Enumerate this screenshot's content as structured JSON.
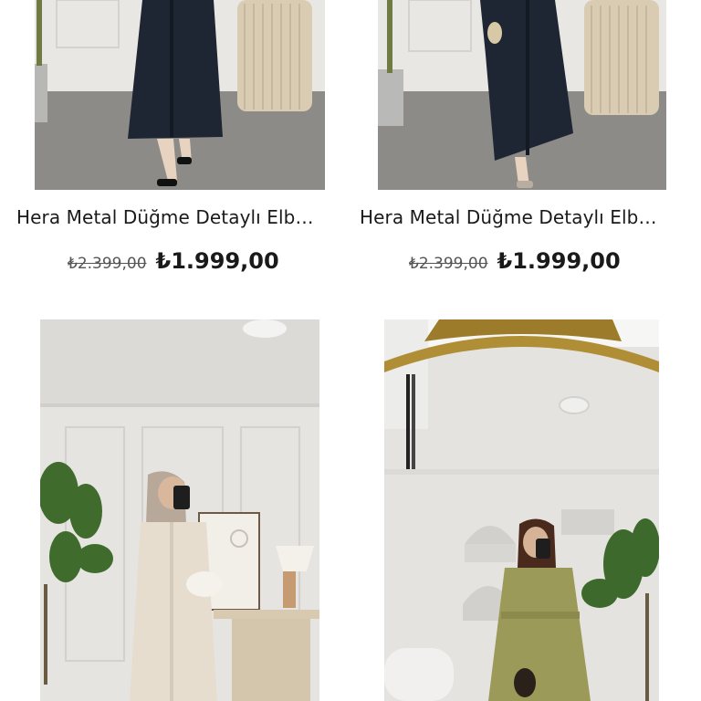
{
  "products": [
    {
      "name": "Hera Metal Düğme Detaylı Elb…",
      "old_price": "₺2.399,00",
      "price": "₺1.999,00",
      "image": "navy-shirt-dress-photo"
    },
    {
      "name": "Hera Metal Düğme Detaylı Elb…",
      "old_price": "₺2.399,00",
      "price": "₺1.999,00",
      "image": "navy-shirt-dress-photo"
    },
    {
      "image": "beige-dress-mirror-selfie-photo"
    },
    {
      "image": "olive-dress-mirror-selfie-photo"
    }
  ]
}
